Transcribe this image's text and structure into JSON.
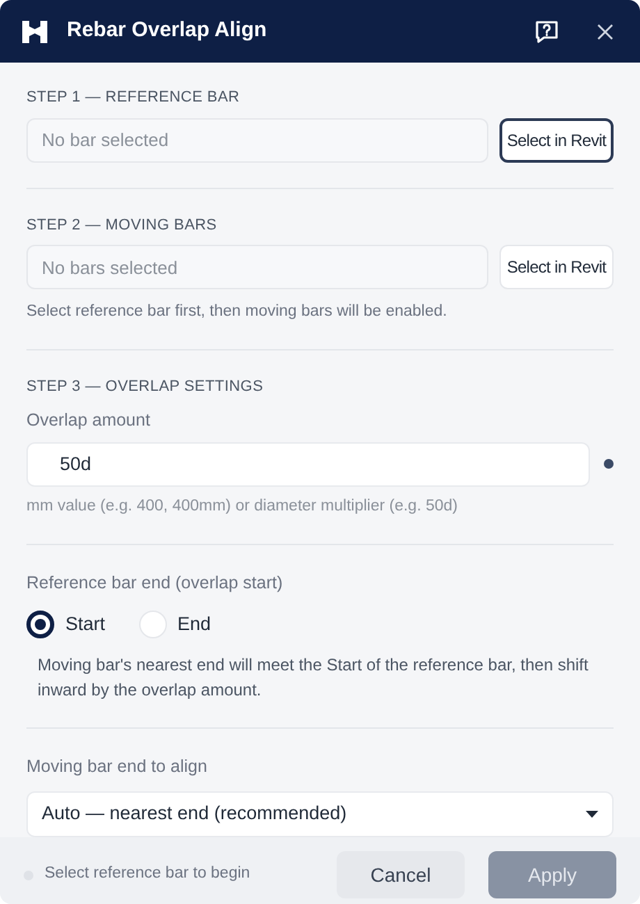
{
  "window": {
    "title": "Rebar Overlap Align"
  },
  "step1": {
    "heading": "STEP 1 — REFERENCE BAR",
    "field": {
      "placeholder": "No bar selected"
    },
    "button": {
      "label": "Select in Revit",
      "focused": true
    }
  },
  "step2": {
    "heading": "STEP 2 — MOVING BARS",
    "field": {
      "placeholder": "No bars selected"
    },
    "button": {
      "label": "Select in Revit",
      "focused": false
    },
    "hint": "Select reference bar first, then moving bars will be enabled."
  },
  "step3": {
    "heading": "STEP 3 — OVERLAP SETTINGS",
    "overlap_label": "Overlap amount",
    "overlap_value": "50d",
    "overlap_hint": "mm value (e.g. 400, 400mm) or diameter multiplier (e.g. 50d)",
    "end_label": "Reference bar end (overlap start)",
    "radios": [
      {
        "label": "Start",
        "selected": true
      },
      {
        "label": "End",
        "selected": false
      }
    ],
    "end_description": "Moving bar's nearest end will meet the Start of the reference bar, then shift inward by the overlap amount.",
    "align_label": "Moving bar end to align",
    "align_value": "Auto — nearest end (recommended)"
  },
  "footer": {
    "status": "Select reference bar to begin",
    "buttons": [
      {
        "label": "Cancel",
        "kind": "secondary",
        "disabled": false
      },
      {
        "label": "Apply",
        "kind": "primary",
        "disabled": true
      }
    ]
  }
}
